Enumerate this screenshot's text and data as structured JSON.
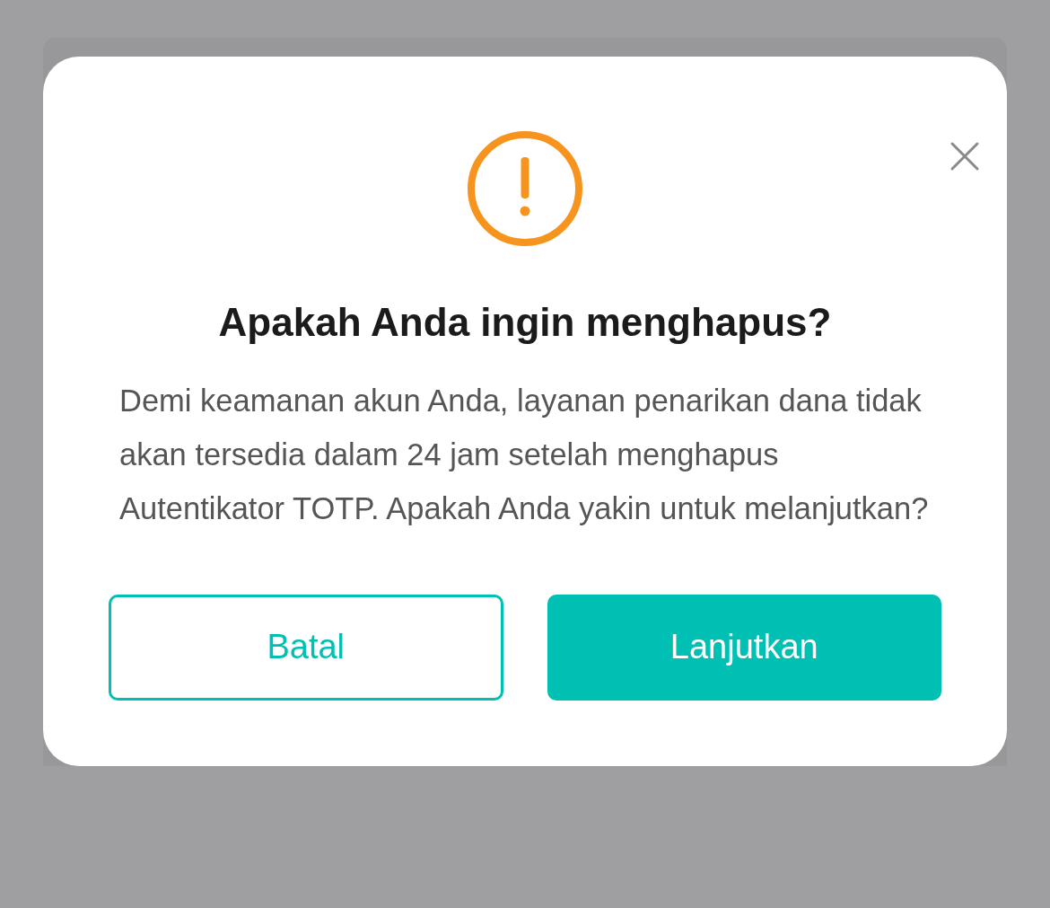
{
  "dialog": {
    "title": "Apakah Anda ingin menghapus?",
    "message": "Demi keamanan akun Anda, layanan penarikan dana tidak akan tersedia dalam 24 jam setelah menghapus Autentikator TOTP. Apakah Anda yakin untuk melanjutkan?",
    "buttons": [
      {
        "label": "Batal",
        "kind": "secondary"
      },
      {
        "label": "Lanjutkan",
        "kind": "primary"
      }
    ]
  }
}
